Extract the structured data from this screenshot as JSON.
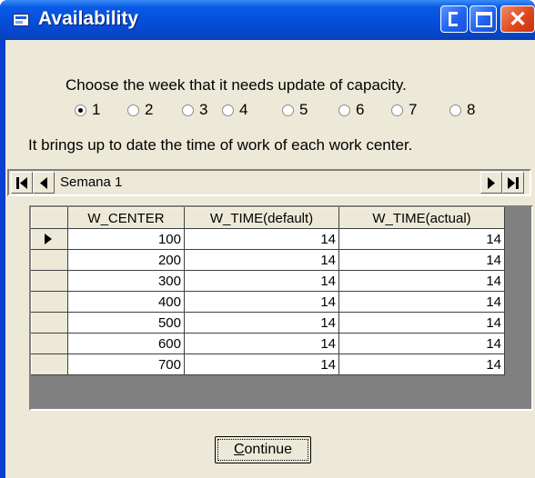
{
  "window": {
    "title": "Availability"
  },
  "prompt": "Choose the week that it needs update of capacity.",
  "weeks": {
    "options": [
      "1",
      "2",
      "3",
      "4",
      "5",
      "6",
      "7",
      "8"
    ],
    "selected": "1"
  },
  "subtitle": "It brings up to date the time of work of each  work center.",
  "navigator": {
    "caption": "Semana 1"
  },
  "grid": {
    "columns": [
      "W_CENTER",
      "W_TIME(default)",
      "W_TIME(actual)"
    ],
    "rows": [
      [
        "100",
        "14",
        "14"
      ],
      [
        "200",
        "14",
        "14"
      ],
      [
        "300",
        "14",
        "14"
      ],
      [
        "400",
        "14",
        "14"
      ],
      [
        "500",
        "14",
        "14"
      ],
      [
        "600",
        "14",
        "14"
      ],
      [
        "700",
        "14",
        "14"
      ]
    ],
    "current_row": 1
  },
  "continue_button": {
    "accel": "C",
    "rest": "ontinue"
  },
  "colors": {
    "title_bar": "#0550dc",
    "client_bg": "#ece9d8",
    "close_button": "#e0481e"
  }
}
